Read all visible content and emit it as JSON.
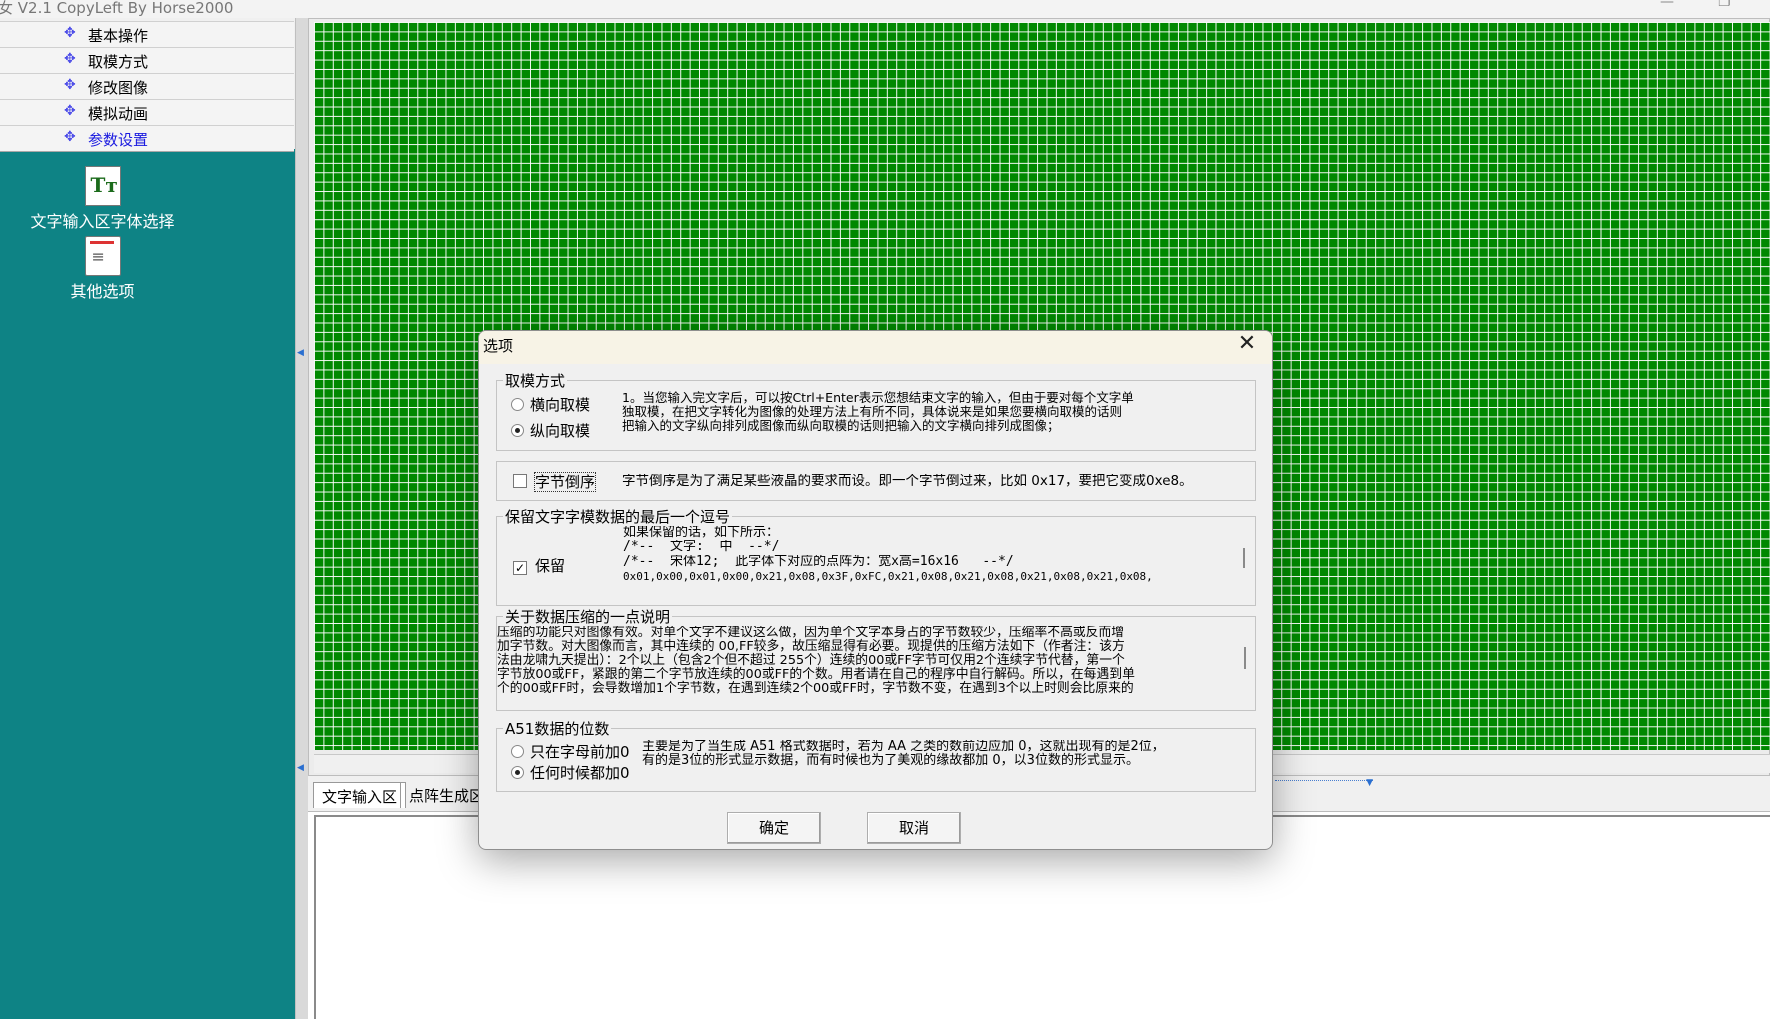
{
  "window": {
    "title": "女 V2.1  CopyLeft By Horse2000",
    "minimize": "—",
    "restore": "❐"
  },
  "sidebar": {
    "menu": [
      {
        "label": "基本操作",
        "active": false
      },
      {
        "label": "取模方式",
        "active": false
      },
      {
        "label": "修改图像",
        "active": false
      },
      {
        "label": "模拟动画",
        "active": false
      },
      {
        "label": "参数设置",
        "active": true
      }
    ],
    "bullet": "✥",
    "tools": [
      {
        "label": "文字输入区字体选择",
        "icon": "font-tt-icon",
        "glyph": "Tт"
      },
      {
        "label": "其他选项",
        "icon": "document-icon",
        "glyph": "≡"
      }
    ]
  },
  "bottom_tabs": [
    "文字输入区",
    "点阵生成区"
  ],
  "dialog": {
    "title": "选项",
    "close": "✕",
    "mode_group": {
      "legend": "取模方式",
      "options": [
        {
          "label": "横向取模",
          "checked": false
        },
        {
          "label": "纵向取模",
          "checked": true
        }
      ],
      "desc": "1。当您输入完文字后，可以按Ctrl+Enter表示您想结束文字的输入，但由于要对每个文字单\n独取模，在把文字转化为图像的处理方法上有所不同，具体说来是如果您要横向取模的话则\n把输入的文字纵向排列成图像而纵向取模的话则把输入的文字横向排列成图像；"
    },
    "byte_reverse": {
      "label": "字节倒序",
      "checked": false,
      "desc": "字节倒序是为了满足某些液晶的要求而设。即一个字节倒过来，比如 0x17，要把它变成0xe8。"
    },
    "comma_group": {
      "legend": "保留文字字模数据的最后一个逗号",
      "check_label": "保留",
      "checked": true,
      "desc_lines": [
        "如果保留的话，如下所示：",
        "/*--  文字:  中  --*/",
        "/*--  宋体12;  此字体下对应的点阵为：宽x高=16x16   --*/",
        "0x01,0x00,0x01,0x00,0x21,0x08,0x3F,0xFC,0x21,0x08,0x21,0x08,0x21,0x08,0x21,0x08,"
      ]
    },
    "compress_group": {
      "legend": "关于数据压缩的一点说明",
      "text": "压缩的功能只对图像有效。对单个文字不建议这么做，因为单个文字本身占的字节数较少，压缩率不高或反而增\n加字节数。对大图像而言，其中连续的 00,FF较多，故压缩显得有必要。现提供的压缩方法如下（作者注：该方\n法由龙啸九天提出）：2个以上（包含2个但不超过 255个）连续的00或FF字节可仅用2个连续字节代替，第一个\n字节放00或FF，紧跟的第二个字节放连续的00或FF的个数。用者请在自己的程序中自行解码。所以，在每遇到单\n个的00或FF时，会导数增加1个字节数，在遇到连续2个00或FF时，字节数不变，在遇到3个以上时则会比原来的"
    },
    "a51_group": {
      "legend": "A51数据的位数",
      "options": [
        {
          "label": "只在字母前加0",
          "checked": false
        },
        {
          "label": "任何时候都加0",
          "checked": true
        }
      ],
      "desc": "主要是为了当生成 A51 格式数据时，若为 AA 之类的数前边应加 0，这就出现有的是2位，\n有的是3位的形式显示数据，而有时候也为了美观的缘故都加 0，以3位数的形式显示。"
    },
    "ok": "确定",
    "cancel": "取消"
  },
  "colors": {
    "grid_bg": "#008800",
    "grid_line": "#ffffff",
    "sidebar_bg": "#0e8385",
    "active_menu": "#1a1ae0"
  }
}
